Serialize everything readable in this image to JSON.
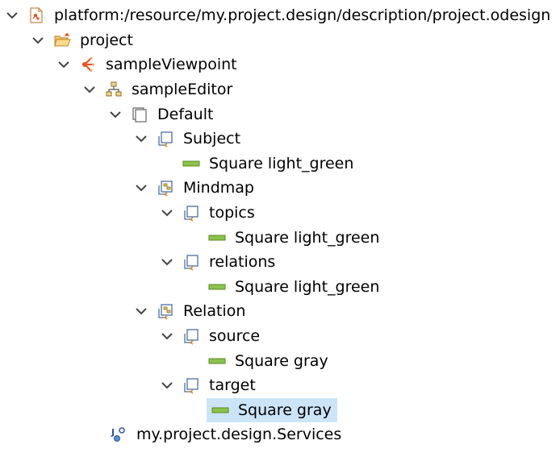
{
  "tree": {
    "root": {
      "label": "platform:/resource/my.project.design/description/project.odesign",
      "icon": "odesign-file-icon"
    },
    "project": {
      "label": "project",
      "icon": "open-folder-icon"
    },
    "viewpoint": {
      "label": "sampleViewpoint",
      "icon": "viewpoint-icon"
    },
    "editor": {
      "label": "sampleEditor",
      "icon": "diagram-editor-icon"
    },
    "default_layer": {
      "label": "Default",
      "icon": "layer-icon"
    },
    "subject": {
      "label": "Subject",
      "icon": "node-mapping-icon"
    },
    "subject_style": {
      "label": "Square light_green",
      "icon": "square-style-icon",
      "color": "#8bc34a"
    },
    "mindmap": {
      "label": "Mindmap",
      "icon": "container-mapping-icon"
    },
    "topics": {
      "label": "topics",
      "icon": "node-mapping-icon"
    },
    "topics_style": {
      "label": "Square light_green",
      "icon": "square-style-icon",
      "color": "#8bc34a"
    },
    "relations": {
      "label": "relations",
      "icon": "node-mapping-icon"
    },
    "relations_style": {
      "label": "Square light_green",
      "icon": "square-style-icon",
      "color": "#8bc34a"
    },
    "relation": {
      "label": "Relation",
      "icon": "container-mapping-icon"
    },
    "source": {
      "label": "source",
      "icon": "node-mapping-icon"
    },
    "source_style": {
      "label": "Square gray",
      "icon": "square-style-icon"
    },
    "target": {
      "label": "target",
      "icon": "node-mapping-icon"
    },
    "target_style": {
      "label": "Square gray",
      "icon": "square-style-icon",
      "selected": true
    },
    "services": {
      "label": "my.project.design.Services",
      "icon": "java-services-icon"
    }
  },
  "colors": {
    "selection": "#cce4f7",
    "style_green": "#8bc34a",
    "chevron": "#444444"
  }
}
